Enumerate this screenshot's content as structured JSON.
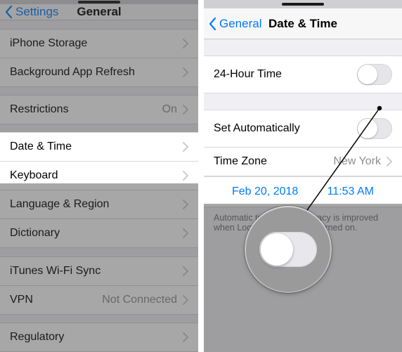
{
  "left": {
    "back_label": "Settings",
    "title": "General",
    "rows": {
      "iphone_storage": "iPhone Storage",
      "bg_refresh": "Background App Refresh",
      "restrictions": "Restrictions",
      "restrictions_value": "On",
      "date_time": "Date & Time",
      "keyboard": "Keyboard",
      "lang_region": "Language & Region",
      "dictionary": "Dictionary",
      "itunes_wifi": "iTunes Wi-Fi Sync",
      "vpn": "VPN",
      "vpn_value": "Not Connected",
      "regulatory": "Regulatory"
    }
  },
  "right": {
    "back_label": "General",
    "title": "Date & Time",
    "rows": {
      "twentyfour": "24-Hour Time",
      "set_auto": "Set Automatically",
      "timezone": "Time Zone",
      "timezone_value": "New York"
    },
    "date_value": "Feb 20, 2018",
    "time_value": "11:53 AM",
    "footer": "Automatic time zone accuracy is improved when Location Services is turned on."
  }
}
